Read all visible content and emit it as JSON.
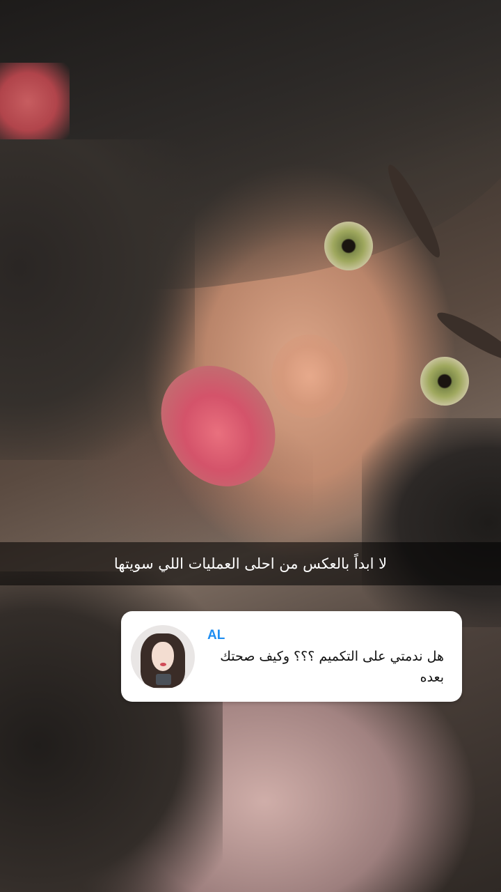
{
  "story": {
    "caption": "لا ابداً بالعكس من احلى العمليات اللي سويتها"
  },
  "question_sticker": {
    "sender": "AL",
    "question": "هل ندمتي على التكميم ؟؟؟ وكيف صحتك بعده",
    "avatar_icon": "memoji-avatar-icon",
    "sender_color": "#1f8ef1",
    "background_color": "#ffffff"
  }
}
